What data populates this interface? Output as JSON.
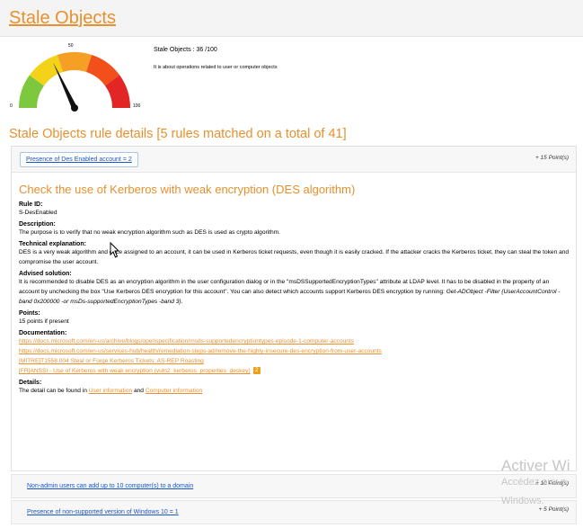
{
  "header": {
    "title": "Stale Objects"
  },
  "gauge": {
    "value": 36,
    "min_label": "0",
    "mid_label": "50",
    "max_label": "100",
    "colors": [
      "#7dc83c",
      "#f3d21a",
      "#f5a025",
      "#f24f1b",
      "#e22525"
    ]
  },
  "summary": {
    "score_text": "Stale Objects : 36 /100",
    "description": "It is about operations related to user or computer objects"
  },
  "section": {
    "title": "Stale Objects rule details [5 rules matched on a total of 41]"
  },
  "rule": {
    "link": "Presence of Des Enabled account = 2",
    "points": "+ 15 Point(s)",
    "title": "Check the use of Kerberos with weak encryption (DES algorithm)",
    "id_label": "Rule ID:",
    "id": "S-DesEnabled",
    "desc_label": "Description:",
    "description": "The purpose is to verify that no weak encryption algorithm such as DES is used as crypto algorithm.",
    "tech_label": "Technical explanation:",
    "technical": "DES is a very weak algorithm and once assigned to an account, it can be used in Kerberos ticket requests, even though it is easily cracked. If the attacker cracks the Kerberos ticket, they can steal the token and compromise the user account.",
    "advised_label": "Advised solution:",
    "advised": "It is recommended to disable DES as an encryption algorithm in the user configuration dialog or in the \"msDSSupportedEncryptionTypes\" attribute at LDAP level. It has to be disabled in the property of an account by unchecking the box \"Use Kerberos DES encryption for this account\". You can also detect which accounts support Kerberos DES encryption by running:",
    "advised_cmd": "Get-ADObject -Filter {UserAccountControl -band 0x200000 -or msDs-supportedEncryptionTypes -band 3}.",
    "points_label": "Points:",
    "points_text": "15 points if present",
    "doc_label": "Documentation:",
    "docs": [
      "https://docs.microsoft.com/en-us/archive/blogs/openspecification/msds-supportedencryptiontypes-episode-1-computer-accounts",
      "https://docs.microsoft.com/en-us/services-hub/health/remediation-steps-ad/remove-the-highly-insecure-des-encryption-from-user-accounts",
      "[MITRE]T1558.004 Steal or Forge Kerberos Tickets: AS-REP Roasting",
      "[FR]ANSSI - Use of Kerberos with weak encryption (vuln2_kerberos_properties_deskey)"
    ],
    "doc_badge": "2",
    "details_label": "Details:",
    "details_prefix": "The detail can be found in",
    "details_link1": "User information",
    "details_and": "and",
    "details_link2": "Computer information"
  },
  "other_rules": [
    {
      "link": "Non-admin users can add up to 10 computer(s) to a domain",
      "points": "+ 10 Point(s)"
    },
    {
      "link": "Presence of non-supported version of Windows 10 = 1",
      "points": "+ 5 Point(s)"
    }
  ],
  "watermark": {
    "line1": "Activer Wi",
    "line2": "Accédez aux p",
    "line3": "Windows."
  }
}
